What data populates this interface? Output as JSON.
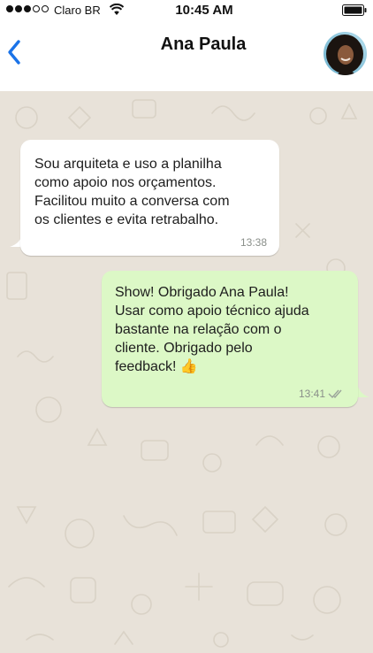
{
  "status_bar": {
    "carrier": "Claro BR",
    "time": "10:45 AM",
    "signal_icon": "signal-dots-icon",
    "wifi_icon": "wifi-icon",
    "battery_icon": "battery-icon"
  },
  "header": {
    "back_icon": "chevron-left-icon",
    "contact_name": "Ana Paula",
    "avatar": "contact-avatar"
  },
  "messages": [
    {
      "direction": "incoming",
      "text": "Sou arquiteta e uso a planilha\ncomo apoio nos orçamentos.\nFacilitou muito a conversa com\nos clientes e evita retrabalho.",
      "time": "13:38"
    },
    {
      "direction": "outgoing",
      "text": "Show! Obrigado Ana Paula!\nUsar como apoio técnico ajuda\nbastante na relação com o\ncliente. Obrigado pelo\nfeedback! 👍",
      "time": "13:41",
      "status_icon": "double-check-icon"
    }
  ],
  "colors": {
    "accent": "#1a73e8",
    "incoming_bubble": "#ffffff",
    "outgoing_bubble": "#dcf8c6",
    "chat_background": "#e8e2d9"
  }
}
